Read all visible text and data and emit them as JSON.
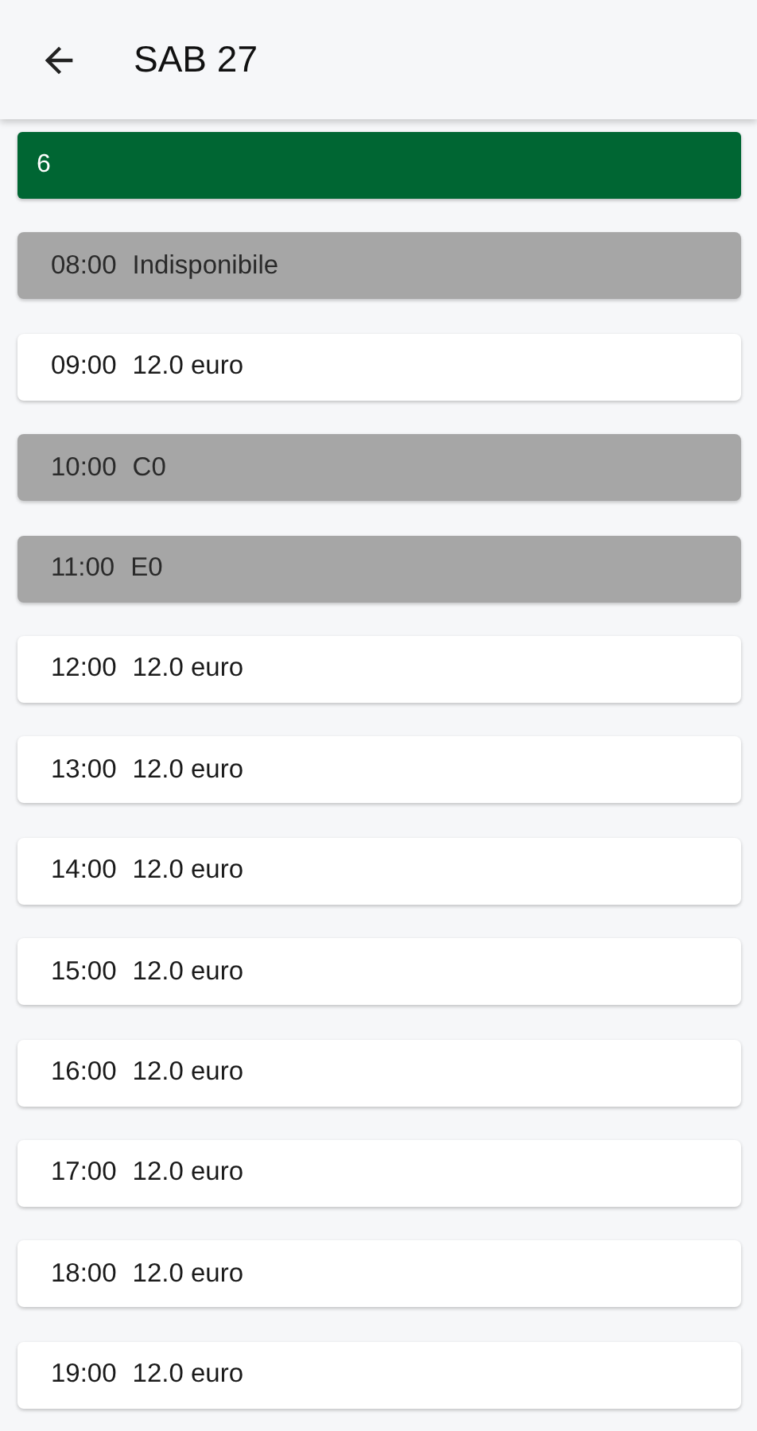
{
  "header": {
    "title": "SAB 27"
  },
  "banner": {
    "label": "6"
  },
  "slots": [
    {
      "time": "08:00",
      "label": "Indisponibile",
      "available": false
    },
    {
      "time": "09:00",
      "label": "12.0 euro",
      "available": true
    },
    {
      "time": "10:00",
      "label": "C0",
      "available": false
    },
    {
      "time": "11:00",
      "label": "E0",
      "available": false
    },
    {
      "time": "12:00",
      "label": "12.0 euro",
      "available": true
    },
    {
      "time": "13:00",
      "label": "12.0 euro",
      "available": true
    },
    {
      "time": "14:00",
      "label": "12.0 euro",
      "available": true
    },
    {
      "time": "15:00",
      "label": "12.0 euro",
      "available": true
    },
    {
      "time": "16:00",
      "label": "12.0 euro",
      "available": true
    },
    {
      "time": "17:00",
      "label": "12.0 euro",
      "available": true
    },
    {
      "time": "18:00",
      "label": "12.0 euro",
      "available": true
    },
    {
      "time": "19:00",
      "label": "12.0 euro",
      "available": true
    }
  ]
}
